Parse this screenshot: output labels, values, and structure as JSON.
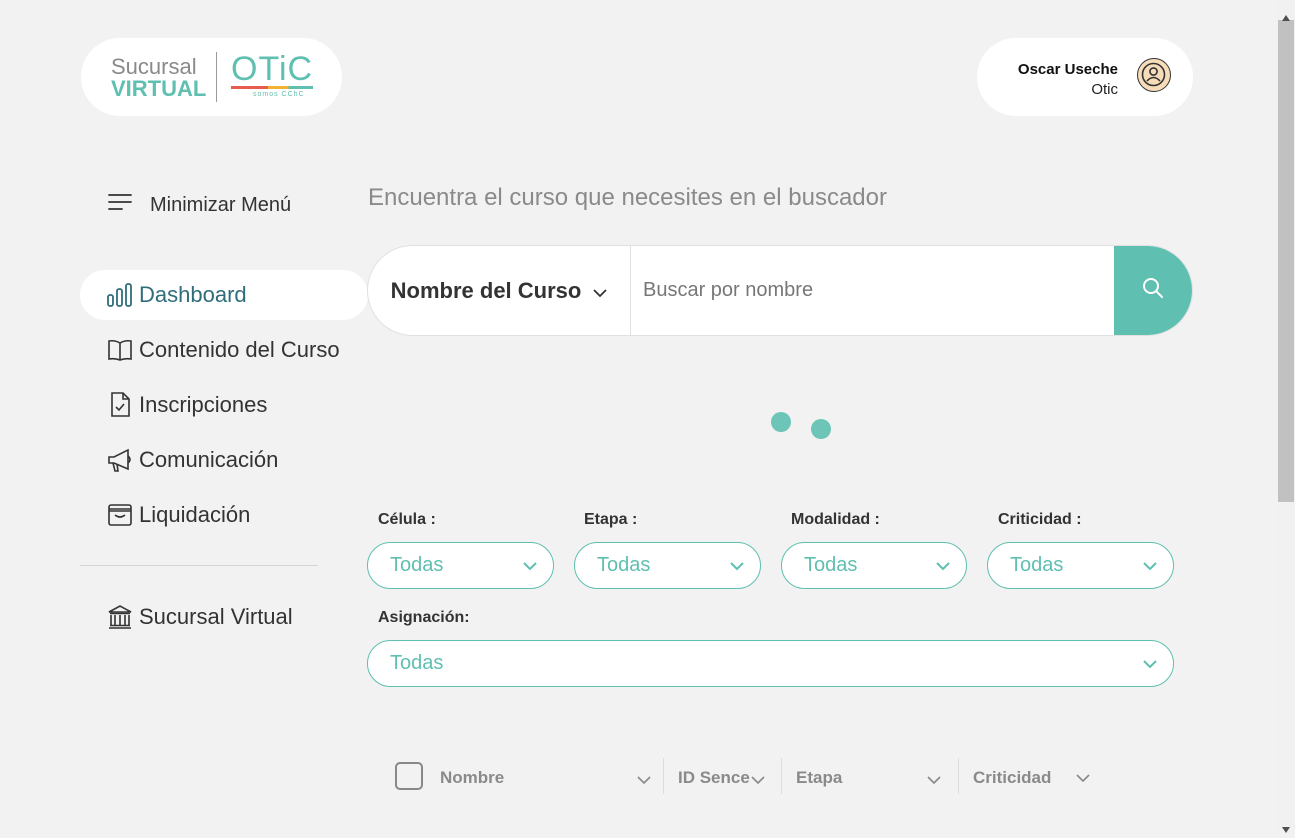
{
  "logo": {
    "line1": "Sucursal",
    "line2": "VIRTUAL",
    "brand": "OTiC",
    "tagline": "somos CChC"
  },
  "user": {
    "name": "Oscar Useche",
    "org": "Otic",
    "icon": "user-circle-icon"
  },
  "sidebar": {
    "minimize_label": "Minimizar Menú",
    "items": [
      {
        "label": "Dashboard",
        "icon": "bar-chart-icon",
        "active": true
      },
      {
        "label": "Contenido del Curso",
        "icon": "book-icon"
      },
      {
        "label": "Inscripciones",
        "icon": "file-check-icon"
      },
      {
        "label": "Comunicación",
        "icon": "megaphone-icon"
      },
      {
        "label": "Liquidación",
        "icon": "wallet-icon"
      }
    ],
    "bottom_item": {
      "label": "Sucursal Virtual",
      "icon": "bank-icon"
    }
  },
  "main": {
    "headline": "Encuentra el curso que necesites en el buscador",
    "search": {
      "type_label": "Nombre del Curso",
      "placeholder": "Buscar por nombre",
      "value": ""
    },
    "filters": [
      {
        "label": "Célula :",
        "value": "Todas"
      },
      {
        "label": "Etapa :",
        "value": "Todas"
      },
      {
        "label": "Modalidad :",
        "value": "Todas"
      },
      {
        "label": "Criticidad :",
        "value": "Todas"
      }
    ],
    "assignment": {
      "label": "Asignación:",
      "value": "Todas"
    },
    "table_headers": [
      "Nombre",
      "ID Sence",
      "Etapa",
      "Criticidad"
    ]
  },
  "colors": {
    "accent": "#5fbfb0",
    "active_text": "#2f6d7a",
    "background": "#f2f2f2"
  }
}
